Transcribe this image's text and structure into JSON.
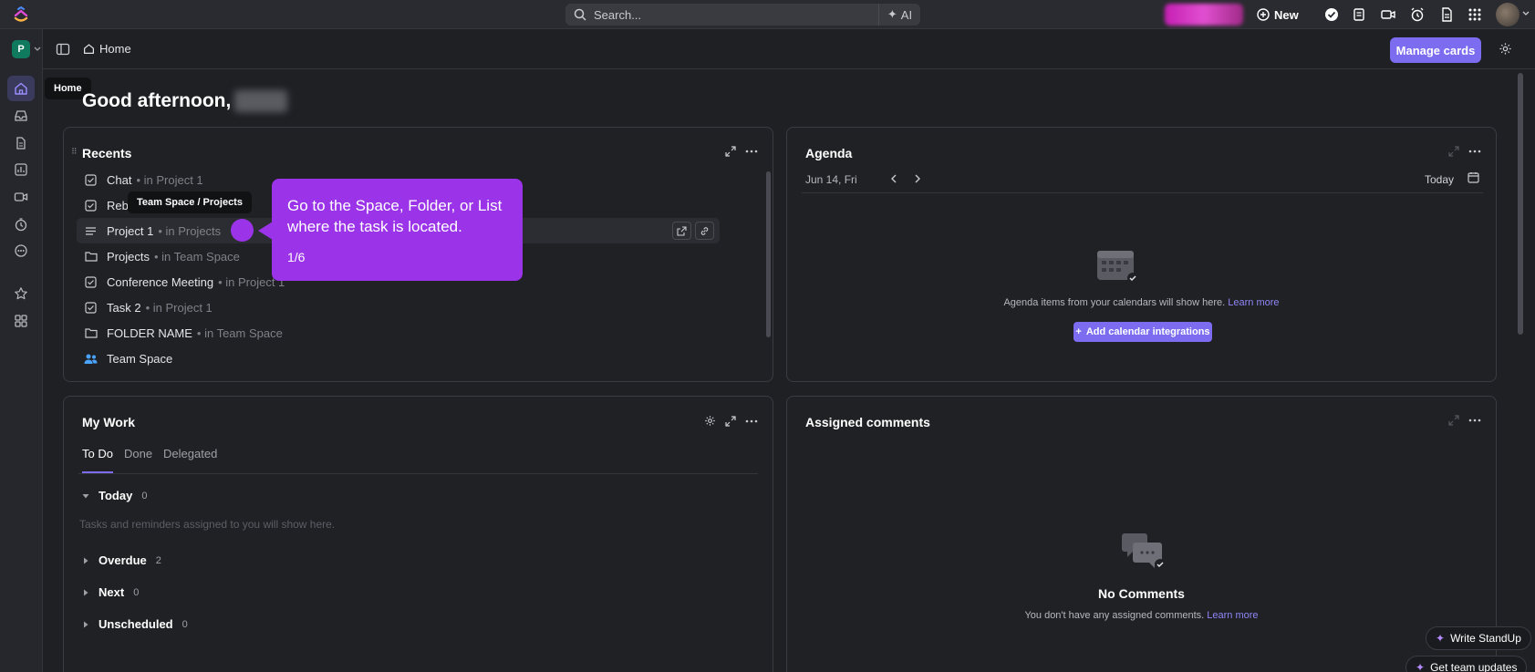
{
  "topbar": {
    "search_placeholder": "Search...",
    "ai_label": "AI",
    "new_label": "New"
  },
  "rail": {
    "workspace_initial": "P",
    "home_tooltip": "Home"
  },
  "header": {
    "breadcrumb": "Home",
    "manage_cards": "Manage cards"
  },
  "greeting": "Good afternoon,",
  "recents": {
    "title": "Recents",
    "items": [
      {
        "name": "Chat",
        "location": "• in Project 1",
        "icon": "task-icon"
      },
      {
        "name": "Rebr",
        "location": "",
        "icon": "task-icon"
      },
      {
        "name": "Project 1",
        "location": "• in Projects",
        "icon": "list-icon"
      },
      {
        "name": "Projects",
        "location": "• in Team Space",
        "icon": "folder-icon"
      },
      {
        "name": "Conference Meeting",
        "location": "• in Project 1",
        "icon": "task-icon"
      },
      {
        "name": "Task 2",
        "location": "• in Project 1",
        "icon": "task-icon"
      },
      {
        "name": "FOLDER NAME",
        "location": "• in Team Space",
        "icon": "folder-icon"
      },
      {
        "name": "Team Space",
        "location": "",
        "icon": "people-icon"
      }
    ],
    "path_tooltip": "Team Space / Projects"
  },
  "callout": {
    "text": "Go to the Space, Folder, or List where the task is located.",
    "step": "1/6",
    "color": "#9b33e8"
  },
  "agenda": {
    "title": "Agenda",
    "date": "Jun 14, Fri",
    "today": "Today",
    "empty_text": "Agenda items from your calendars will show here.",
    "learn_more": "Learn more",
    "add_button": "Add calendar integrations"
  },
  "my_work": {
    "title": "My Work",
    "tabs": [
      "To Do",
      "Done",
      "Delegated"
    ],
    "hint": "Tasks and reminders assigned to you will show here.",
    "groups": [
      {
        "name": "Today",
        "count": "0"
      },
      {
        "name": "Overdue",
        "count": "2"
      },
      {
        "name": "Next",
        "count": "0"
      },
      {
        "name": "Unscheduled",
        "count": "0"
      }
    ]
  },
  "assigned_comments": {
    "title": "Assigned comments",
    "empty_title": "No Comments",
    "empty_text": "You don't have any assigned comments.",
    "learn_more": "Learn more"
  },
  "floating": {
    "write_standup": "Write StandUp",
    "get_updates": "Get team updates"
  },
  "colors": {
    "accent": "#7b6cf0",
    "callout": "#9b33e8",
    "background": "#1f2024"
  }
}
